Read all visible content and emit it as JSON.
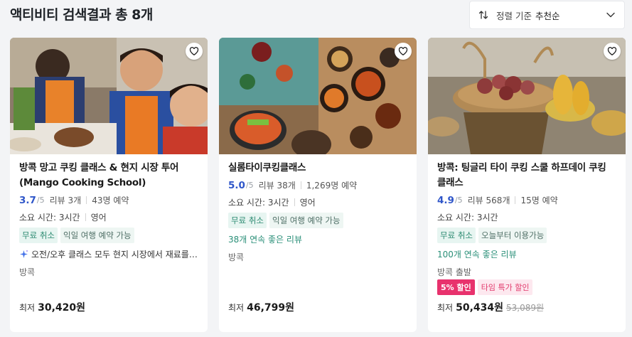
{
  "header": {
    "title": "액티비티 검색결과 총 8개"
  },
  "sort": {
    "label": "정렬 기준",
    "value": "추천순"
  },
  "cards": [
    {
      "name": "방콕 망고 쿠킹 클래스 & 현지 시장 투어 (Mango Cooking School)",
      "rating": "3.7",
      "out_of": "/5",
      "reviews": "리뷰 3개",
      "bookings": "43명 예약",
      "duration": "소요 시간: 3시간",
      "language": "영어",
      "tags": [
        "무료 취소",
        "익일 여행 예약 가능"
      ],
      "extra": "오전/오후 클래스 모두 현지 시장에서 재료를 구매합니다",
      "location": "방콕",
      "price_prefix": "최저",
      "price": "30,420원"
    },
    {
      "name": "실롬타이쿠킹클래스",
      "rating": "5.0",
      "out_of": "/5",
      "reviews": "리뷰 38개",
      "bookings": "1,269명 예약",
      "duration": "소요 시간: 3시간",
      "language": "영어",
      "tags": [
        "무료 취소",
        "익일 여행 예약 가능"
      ],
      "extra": "38개 연속 좋은 리뷰",
      "location": "방콕",
      "price_prefix": "최저",
      "price": "46,799원"
    },
    {
      "name": "방콕: 팅글리 타이 쿠킹 스쿨 하프데이 쿠킹 클래스",
      "rating": "4.9",
      "out_of": "/5",
      "reviews": "리뷰 568개",
      "bookings": "15명 예약",
      "duration": "소요 시간: 3시간",
      "tags": [
        "무료 취소",
        "오늘부터 이용가능"
      ],
      "extra": "100개 연속 좋은 리뷰",
      "location": "방콕 출발",
      "sale_badges": [
        "5% 할인",
        "타임 특가 할인"
      ],
      "price_prefix": "최저",
      "price": "50,434원",
      "original_price": "53,089원"
    }
  ],
  "colors": {
    "rating": "#2f56c9",
    "streak": "#2a8f78",
    "sale": "#e8326d"
  },
  "icons": {
    "sort": "sort-arrows-icon",
    "dropdown": "chevron-down-icon",
    "wishlist": "heart-icon",
    "sparkle": "sparkle-icon"
  }
}
